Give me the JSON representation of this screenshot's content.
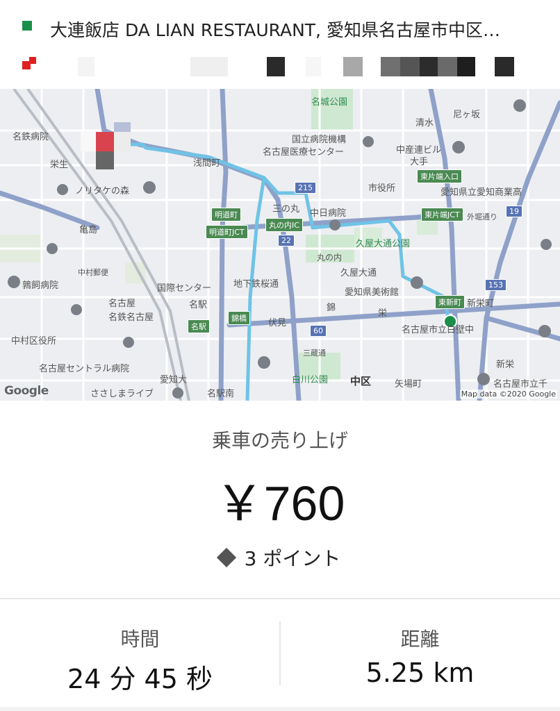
{
  "trip": {
    "pickup_address": "大連飯店 DA LIAN RESTAURANT, 愛知県名古屋市中区…",
    "pickup_marker_color": "#1a8f4a",
    "dropoff_marker_color": "#e02020"
  },
  "map": {
    "attribution": "Map data ©2020 Google",
    "google_logo": "Google",
    "labels": {
      "meitetsu_hospital": "名鉄病院",
      "nagoya_castle_park": "名城公園",
      "national_hospital": "国立病院機構",
      "nagoya_medical_center": "名古屋医療センター",
      "chunichi_building": "中産連ビル",
      "shimizu": "清水",
      "owari": "尼ヶ坂",
      "asamacho": "浅間町",
      "noritake": "ノリタケの森",
      "ohzone": "大手",
      "city_office": "市役所",
      "prefecture_commercial": "愛知県立愛知商業高",
      "sakae_ikuta": "栄生",
      "sannomaru": "三の丸",
      "chunichi_hospital": "中日病院",
      "gaido": "外堀通り",
      "kameshima": "亀島",
      "hisaya_park": "久屋大通公園",
      "marunouchi": "丸の内",
      "hisaya_odori": "久屋大通",
      "chikatetsu": "地下鉄桜通",
      "nakamura_hospital": "中村郵便",
      "ishigaki_hospital": "鶉飼病院",
      "kokusai_center": "国際センター",
      "art_museum": "愛知県美術館",
      "nagoya": "名古屋",
      "meieki": "名駅",
      "nishiki": "錦",
      "sakae": "栄",
      "shinsakaemachi": "新栄町",
      "meitetsu_nagoya": "名鉄名古屋",
      "fushimi": "伏見",
      "city_shirakabe": "名古屋市立白壁中",
      "nakamura_ward_office": "中村区役所",
      "sandoori": "三蔵通",
      "nagoya_central_hospital": "名古屋セントラル病院",
      "shirakawa_park": "白川公園",
      "naka_ward": "中区",
      "yabacho": "矢場町",
      "aichi_univ": "愛知大",
      "meieki_minami": "名駅南",
      "shinsakae": "新栄",
      "nagoya_city_chikusa": "名古屋市立千",
      "sasashima": "ささしまライブ",
      "higashi_kataha": "東片端入口",
      "higashi_kataha_jct": "東片端JCT",
      "meidou": "明道町",
      "meidou_jct": "明道町JCT",
      "marunouchi_ic": "丸の内IC",
      "higashi_shinmachi": "東新町",
      "nishiki_bridge": "錦橋",
      "meieki_shield": "名駅",
      "fushimi_station": "伏見",
      "route_22": "22",
      "route_215": "215",
      "route_153": "153",
      "route_60": "60",
      "route_19": "19"
    }
  },
  "fare": {
    "label": "乗車の売り上げ",
    "amount": "￥760",
    "points": "3 ポイント"
  },
  "stats": {
    "duration_label": "時間",
    "duration_value": "24 分 45 秒",
    "distance_label": "距離",
    "distance_value": "5.25 km"
  },
  "icons": {
    "points": "diamond-icon"
  }
}
